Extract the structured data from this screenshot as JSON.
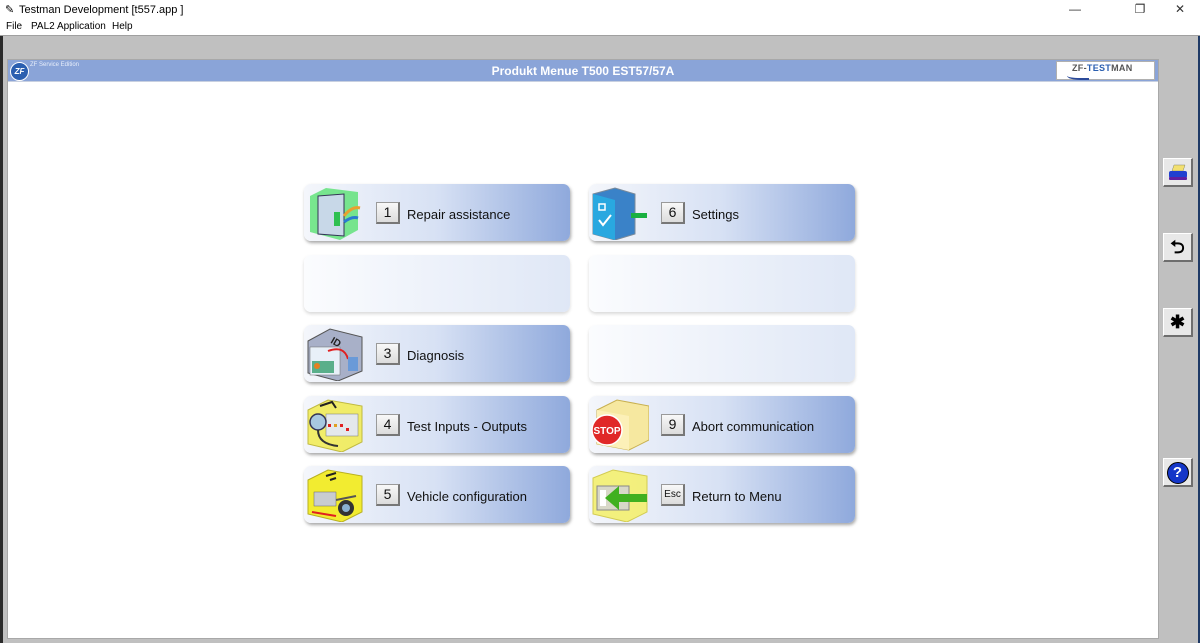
{
  "window": {
    "title": "Testman Development [t557.app     ]",
    "app_icon": "testman-app-icon",
    "controls": {
      "minimize": "—",
      "maximize": "❐",
      "close": "✕"
    }
  },
  "menubar": {
    "items": [
      "File",
      "PAL2 Application",
      "Help"
    ]
  },
  "header": {
    "logo_text": "ZF",
    "edition": "ZF Service Edition",
    "title": "Produkt Menue T500 EST57/57A",
    "brand_prefix": "ZF-",
    "brand_highlight": "TEST",
    "brand_suffix": "MAN"
  },
  "menu": {
    "tiles": [
      {
        "key": "1",
        "label": "Repair assistance",
        "icon": "repair-assistance-icon",
        "enabled": true
      },
      {
        "key": "6",
        "label": "Settings",
        "icon": "settings-icon",
        "enabled": true
      },
      {
        "key": "",
        "label": "",
        "icon": "",
        "enabled": false
      },
      {
        "key": "",
        "label": "",
        "icon": "",
        "enabled": false
      },
      {
        "key": "3",
        "label": "Diagnosis",
        "icon": "diagnosis-id-icon",
        "enabled": true
      },
      {
        "key": "",
        "label": "",
        "icon": "",
        "enabled": false
      },
      {
        "key": "4",
        "label": "Test Inputs - Outputs",
        "icon": "test-io-icon",
        "enabled": true
      },
      {
        "key": "9",
        "label": "Abort communication",
        "icon": "stop-icon",
        "enabled": true
      },
      {
        "key": "5",
        "label": "Vehicle configuration",
        "icon": "vehicle-config-icon",
        "enabled": true
      },
      {
        "key": "Esc",
        "label": "Return to Menu",
        "icon": "return-arrow-icon",
        "enabled": true
      }
    ]
  },
  "sidebar": {
    "buttons": [
      {
        "name": "print",
        "icon": "printer-icon"
      },
      {
        "name": "back",
        "icon": "undo-arrow-icon",
        "glyph": "⮌"
      },
      {
        "name": "asterisk",
        "icon": "asterisk-icon",
        "glyph": "✱"
      },
      {
        "name": "help",
        "icon": "help-icon",
        "glyph": "?"
      }
    ]
  }
}
